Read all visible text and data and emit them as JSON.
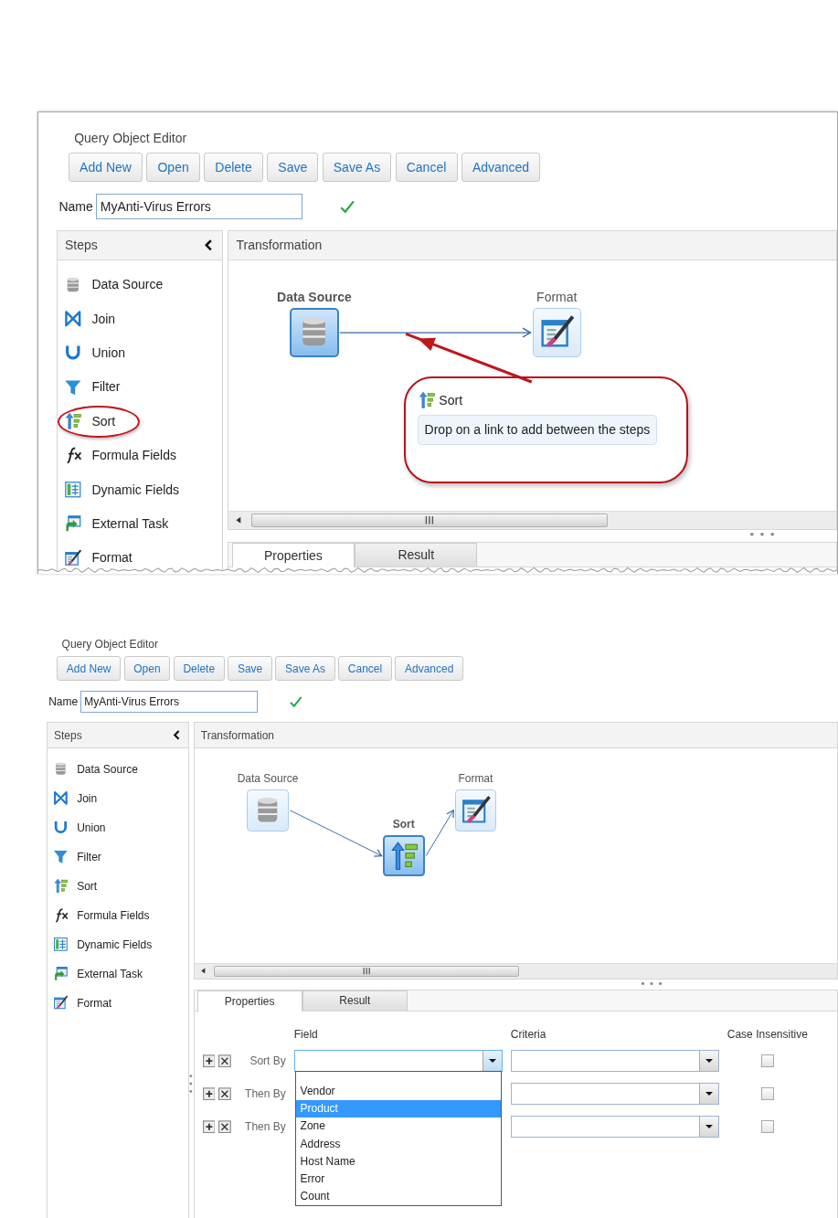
{
  "screens": [
    {
      "title": "Query Object Editor",
      "buttons": [
        "Add New",
        "Open",
        "Delete",
        "Save",
        "Save As",
        "Cancel",
        "Advanced"
      ],
      "name": {
        "label": "Name",
        "value": "MyAnti-Virus Errors",
        "valid": true
      },
      "steps_panel": {
        "title": "Steps",
        "items": [
          {
            "label": "Data Source",
            "kind": "datasource",
            "circled": false
          },
          {
            "label": "Join",
            "kind": "join",
            "circled": false
          },
          {
            "label": "Union",
            "kind": "union",
            "circled": false
          },
          {
            "label": "Filter",
            "kind": "filter",
            "circled": false
          },
          {
            "label": "Sort",
            "kind": "sort",
            "circled": true
          },
          {
            "label": "Formula Fields",
            "kind": "formula",
            "circled": false
          },
          {
            "label": "Dynamic Fields",
            "kind": "dynamic",
            "circled": false
          },
          {
            "label": "External Task",
            "kind": "external",
            "circled": false
          },
          {
            "label": "Format",
            "kind": "format",
            "circled": false
          }
        ]
      },
      "transformation": {
        "title": "Transformation",
        "nodes": [
          {
            "label": "Data Source",
            "kind": "datasource",
            "selected": true
          },
          {
            "label": "Format",
            "kind": "format",
            "selected": false
          }
        ],
        "callout": {
          "label": "Sort",
          "kind": "sort",
          "hint": "Drop on a link to add between the steps"
        }
      },
      "tabs": [
        {
          "label": "Properties",
          "selected": true
        },
        {
          "label": "Result",
          "selected": false
        }
      ]
    },
    {
      "title": "Query Object Editor",
      "buttons": [
        "Add New",
        "Open",
        "Delete",
        "Save",
        "Save As",
        "Cancel",
        "Advanced"
      ],
      "name": {
        "label": "Name",
        "value": "MyAnti-Virus Errors",
        "valid": true
      },
      "steps_panel": {
        "title": "Steps",
        "items": [
          {
            "label": "Data Source",
            "kind": "datasource",
            "circled": false
          },
          {
            "label": "Join",
            "kind": "join",
            "circled": false
          },
          {
            "label": "Union",
            "kind": "union",
            "circled": false
          },
          {
            "label": "Filter",
            "kind": "filter",
            "circled": false
          },
          {
            "label": "Sort",
            "kind": "sort",
            "circled": false
          },
          {
            "label": "Formula Fields",
            "kind": "formula",
            "circled": false
          },
          {
            "label": "Dynamic Fields",
            "kind": "dynamic",
            "circled": false
          },
          {
            "label": "External Task",
            "kind": "external",
            "circled": false
          },
          {
            "label": "Format",
            "kind": "format",
            "circled": false
          }
        ]
      },
      "transformation": {
        "title": "Transformation",
        "nodes": [
          {
            "label": "Data Source",
            "kind": "datasource",
            "selected": false
          },
          {
            "label": "Sort",
            "kind": "sort",
            "selected": true
          },
          {
            "label": "Format",
            "kind": "format",
            "selected": false
          }
        ]
      },
      "tabs": [
        {
          "label": "Properties",
          "selected": true
        },
        {
          "label": "Result",
          "selected": false
        }
      ],
      "properties": {
        "columns": [
          "Field",
          "Criteria",
          "Case Insensitive"
        ],
        "rows": [
          {
            "label": "Sort By",
            "case_insensitive": false,
            "dropdown": {
              "options": [
                {
                  "label": "Vendor",
                  "selected": false
                },
                {
                  "label": "Product",
                  "selected": true
                },
                {
                  "label": "Zone",
                  "selected": false
                },
                {
                  "label": "Address",
                  "selected": false
                },
                {
                  "label": "Host Name",
                  "selected": false
                },
                {
                  "label": "Error",
                  "selected": false
                },
                {
                  "label": "Count",
                  "selected": false
                }
              ]
            }
          },
          {
            "label": "Then By",
            "case_insensitive": false
          },
          {
            "label": "Then By",
            "case_insensitive": false
          }
        ]
      }
    }
  ]
}
